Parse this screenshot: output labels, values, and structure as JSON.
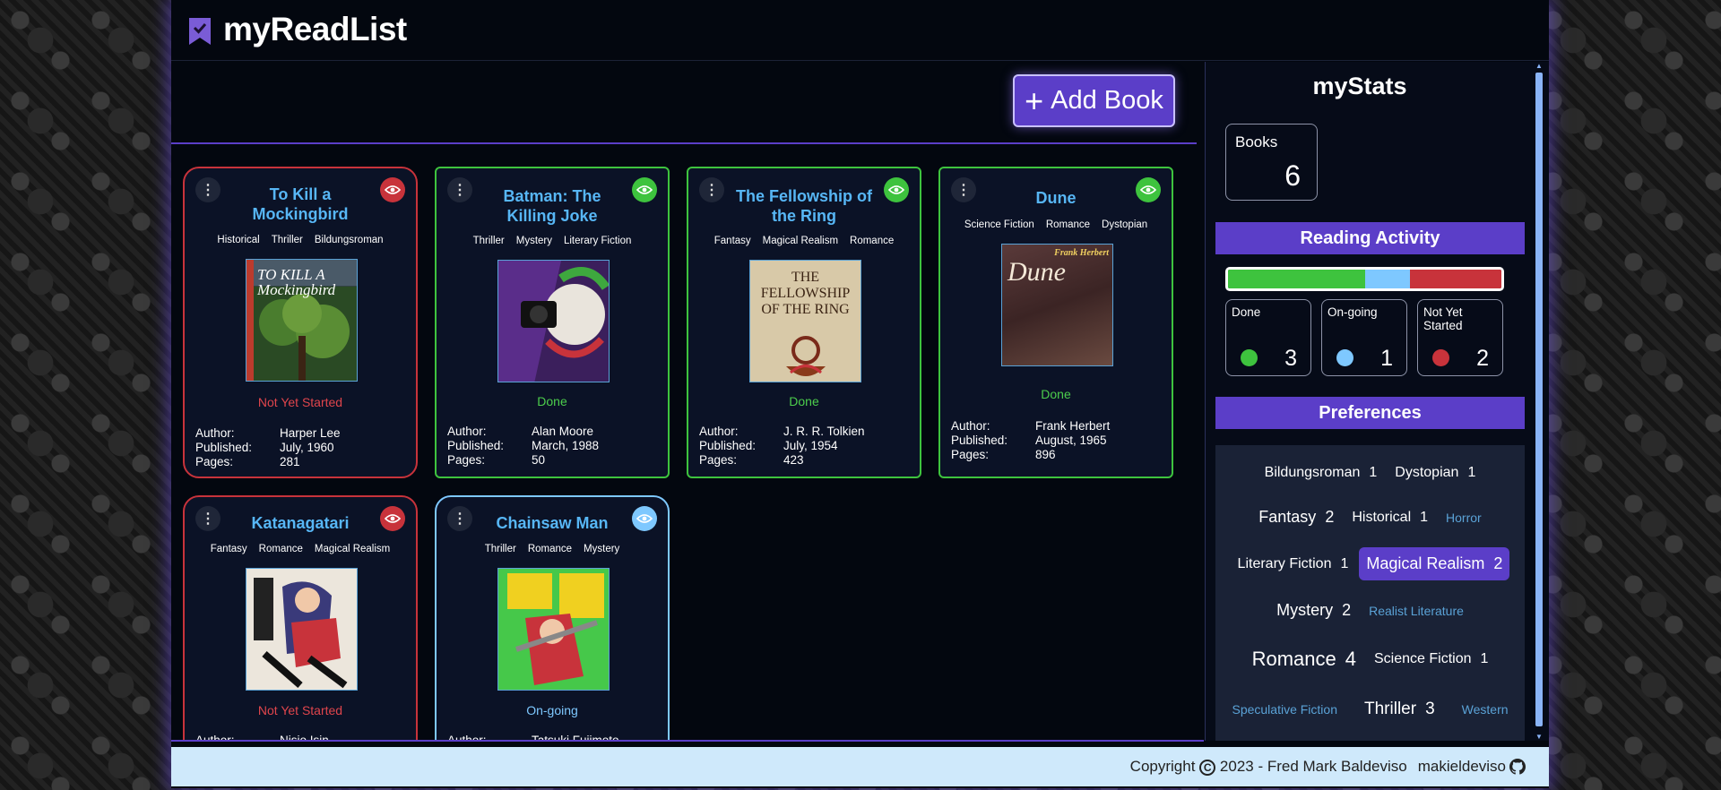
{
  "app": {
    "title": "myReadList"
  },
  "toolbar": {
    "add_label": "Add Book"
  },
  "book_labels": {
    "author": "Author:",
    "published": "Published:",
    "pages": "Pages:"
  },
  "books": [
    {
      "title": "To Kill a Mockingbird",
      "genres": [
        "Historical",
        "Thriller",
        "Bildungsroman"
      ],
      "status": "Not Yet Started",
      "author": "Harper Lee",
      "published": "July, 1960",
      "pages": "281",
      "cover_text": "TO KILL A Mockingbird"
    },
    {
      "title": "Batman: The Killing Joke",
      "genres": [
        "Thriller",
        "Mystery",
        "Literary Fiction"
      ],
      "status": "Done",
      "author": "Alan Moore",
      "published": "March, 1988",
      "pages": "50"
    },
    {
      "title": "The Fellowship of the Ring",
      "genres": [
        "Fantasy",
        "Magical Realism",
        "Romance"
      ],
      "status": "Done",
      "author": "J. R. R. Tolkien",
      "published": "July, 1954",
      "pages": "423",
      "cover_text": "THE FELLOWSHIP OF THE RING"
    },
    {
      "title": "Dune",
      "genres": [
        "Science Fiction",
        "Romance",
        "Dystopian"
      ],
      "status": "Done",
      "author": "Frank Herbert",
      "published": "August, 1965",
      "pages": "896",
      "cover_text": "Dune",
      "cover_author": "Frank Herbert"
    },
    {
      "title": "Katanagatari",
      "genres": [
        "Fantasy",
        "Romance",
        "Magical Realism"
      ],
      "status": "Not Yet Started",
      "author": "Nisio Isin"
    },
    {
      "title": "Chainsaw Man",
      "genres": [
        "Thriller",
        "Romance",
        "Mystery"
      ],
      "status": "On-going",
      "author": "Tatsuki Fujimoto"
    }
  ],
  "stats": {
    "title": "myStats",
    "books_label": "Books",
    "books_count": "6",
    "activity_title": "Reading Activity",
    "activity": {
      "done_label": "Done",
      "done_count": "3",
      "ongoing_label": "On-going",
      "ongoing_count": "1",
      "notstarted_label": "Not Yet Started",
      "notstarted_count": "2"
    },
    "preferences_title": "Preferences",
    "preferences": [
      {
        "name": "Bildungsroman",
        "count": "1"
      },
      {
        "name": "Dystopian",
        "count": "1"
      },
      {
        "name": "Fantasy",
        "count": "2"
      },
      {
        "name": "Historical",
        "count": "1"
      },
      {
        "name": "Horror",
        "count": ""
      },
      {
        "name": "Literary Fiction",
        "count": "1"
      },
      {
        "name": "Magical Realism",
        "count": "2"
      },
      {
        "name": "Mystery",
        "count": "2"
      },
      {
        "name": "Realist Literature",
        "count": ""
      },
      {
        "name": "Romance",
        "count": "4"
      },
      {
        "name": "Science Fiction",
        "count": "1"
      },
      {
        "name": "Speculative Fiction",
        "count": ""
      },
      {
        "name": "Thriller",
        "count": "3"
      },
      {
        "name": "Western",
        "count": ""
      }
    ]
  },
  "footer": {
    "copyright": "Copyright",
    "year_author": "2023 - Fred Mark Baldeviso",
    "github_user": "makieldeviso"
  },
  "colors": {
    "accent": "#5b3ec8",
    "done": "#3ec33e",
    "ongoing": "#7ec8ff",
    "notstarted": "#c8333b",
    "title_blue": "#57b6f5"
  }
}
